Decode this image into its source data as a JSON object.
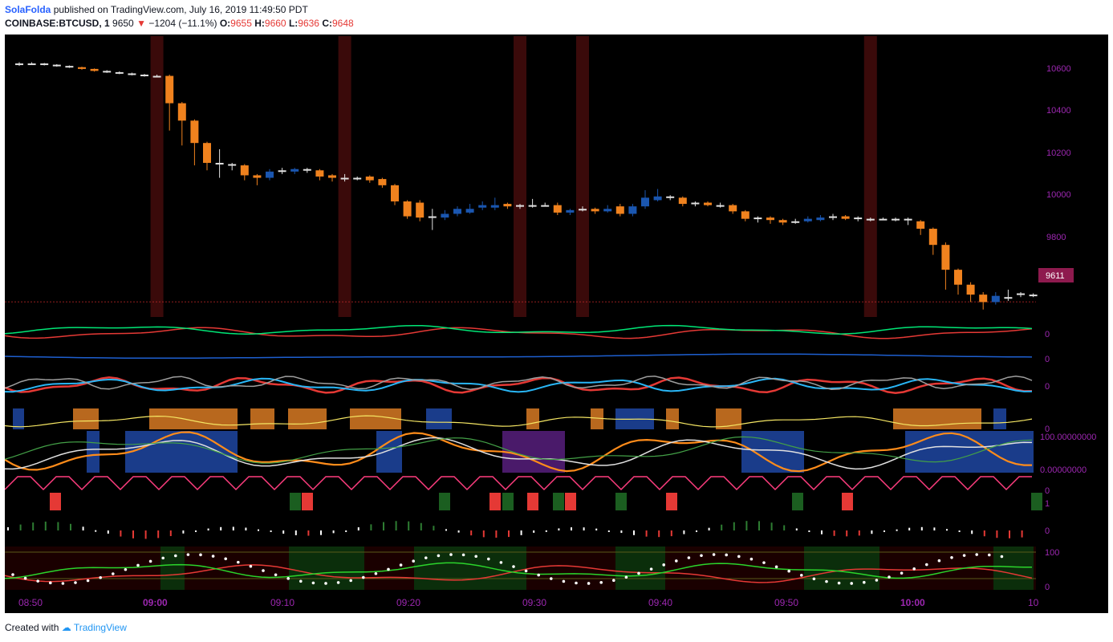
{
  "header": {
    "author": "SolaFolda",
    "published_text": "published on TradingView.com, July 16, 2019 11:49:50 PDT",
    "symbol": "COINBASE:BTCUSD, 1",
    "last": "9650",
    "change": "−1204 (−11.1%)",
    "o_label": "O:",
    "o": "9655",
    "h_label": "H:",
    "h": "9660",
    "l_label": "L:",
    "l": "9636",
    "c_label": "C:",
    "c": "9648"
  },
  "price_axis": {
    "ticks": [
      "10600",
      "10400",
      "10200",
      "10000",
      "9800"
    ],
    "current_price": "9611"
  },
  "indicator_axis": {
    "zero_1": "0",
    "zero_2": "0",
    "zero_3": "0",
    "zero_4": "0",
    "stoch_top": "100.00000000",
    "stoch_bottom": "0.00000000",
    "zero_5": "0",
    "one": "1",
    "zero_6": "0",
    "rsi_top": "100",
    "rsi_bottom": "0"
  },
  "time_axis": [
    "08:50",
    "09:00",
    "09:10",
    "09:20",
    "09:30",
    "09:40",
    "09:50",
    "10:00",
    "10"
  ],
  "footer": {
    "created_with": "Created with",
    "brand": "TradingView"
  },
  "colors": {
    "bull": "#1a56b0",
    "bear": "#f0821e",
    "doji": "#e0e0e0",
    "highlight": "#3a0a0a",
    "price_label_bg": "#8e1a4e",
    "axis_text": "#9c27b0"
  },
  "chart_data": {
    "type": "candlestick",
    "title": "",
    "x": [
      "08:49",
      "08:50",
      "08:51",
      "08:52",
      "08:53",
      "08:54",
      "08:55",
      "08:56",
      "08:57",
      "08:58",
      "08:59",
      "09:00",
      "09:01",
      "09:02",
      "09:03",
      "09:04",
      "09:05",
      "09:06",
      "09:07",
      "09:08",
      "09:09",
      "09:10",
      "09:11",
      "09:12",
      "09:13",
      "09:14",
      "09:15",
      "09:16",
      "09:17",
      "09:18",
      "09:19",
      "09:20",
      "09:21",
      "09:22",
      "09:23",
      "09:24",
      "09:25",
      "09:26",
      "09:27",
      "09:28",
      "09:29",
      "09:30",
      "09:31",
      "09:32",
      "09:33",
      "09:34",
      "09:35",
      "09:36",
      "09:37",
      "09:38",
      "09:39",
      "09:40",
      "09:41",
      "09:42",
      "09:43",
      "09:44",
      "09:45",
      "09:46",
      "09:47",
      "09:48",
      "09:49",
      "09:50",
      "09:51",
      "09:52",
      "09:53",
      "09:54",
      "09:55",
      "09:56",
      "09:57",
      "09:58",
      "09:59",
      "10:00",
      "10:01",
      "10:02",
      "10:03",
      "10:04",
      "10:05",
      "10:06",
      "10:07",
      "10:08",
      "10:09",
      "10:10"
    ],
    "open": [
      10565,
      10570,
      10570,
      10565,
      10560,
      10555,
      10548,
      10540,
      10535,
      10530,
      10525,
      10520,
      10520,
      10410,
      10340,
      10250,
      10170,
      10165,
      10160,
      10120,
      10110,
      10135,
      10135,
      10145,
      10140,
      10120,
      10110,
      10110,
      10115,
      10105,
      10080,
      10015,
      10010,
      9955,
      9950,
      9965,
      9970,
      9990,
      9990,
      10005,
      9995,
      10000,
      10000,
      10000,
      9970,
      9980,
      9985,
      9975,
      9995,
      9965,
      9995,
      10020,
      10035,
      10030,
      10005,
      10010,
      10000,
      10000,
      9975,
      9945,
      9950,
      9940,
      9935,
      9935,
      9940,
      9950,
      9955,
      9950,
      9945,
      9945,
      9945,
      9940,
      9935,
      9905,
      9840,
      9740,
      9680,
      9640,
      9610,
      9625,
      9645,
      9640
    ],
    "close": [
      10570,
      10570,
      10565,
      10560,
      10555,
      10548,
      10540,
      10535,
      10530,
      10525,
      10520,
      10520,
      10410,
      10340,
      10250,
      10170,
      10165,
      10160,
      10120,
      10110,
      10135,
      10140,
      10145,
      10140,
      10115,
      10110,
      10110,
      10110,
      10100,
      10080,
      10015,
      9955,
      9950,
      9955,
      9965,
      9985,
      9985,
      10000,
      10000,
      9995,
      10000,
      10000,
      10000,
      9970,
      9980,
      9985,
      9975,
      9985,
      9965,
      9995,
      10030,
      10035,
      10030,
      10005,
      10010,
      10000,
      10000,
      9975,
      9945,
      9950,
      9940,
      9930,
      9935,
      9945,
      9950,
      9955,
      9945,
      9945,
      9945,
      9945,
      9945,
      9945,
      9905,
      9840,
      9740,
      9680,
      9640,
      9610,
      9635,
      9630,
      9640,
      9640
    ],
    "high": [
      10575,
      10575,
      10572,
      10567,
      10562,
      10557,
      10550,
      10543,
      10538,
      10533,
      10528,
      10525,
      10525,
      10415,
      10345,
      10255,
      10225,
      10170,
      10165,
      10125,
      10145,
      10150,
      10150,
      10150,
      10145,
      10125,
      10125,
      10115,
      10120,
      10110,
      10085,
      10020,
      10020,
      9985,
      9980,
      9995,
      10005,
      10015,
      10030,
      10010,
      10005,
      10025,
      10010,
      10010,
      9985,
      9995,
      9990,
      10000,
      10005,
      10005,
      10060,
      10065,
      10040,
      10035,
      10015,
      10015,
      10010,
      10005,
      9980,
      9955,
      9955,
      9945,
      9945,
      9955,
      9960,
      9965,
      9960,
      9955,
      9950,
      9950,
      9950,
      9950,
      9940,
      9910,
      9850,
      9745,
      9690,
      9650,
      9650,
      9660,
      9650,
      9645
    ],
    "low": [
      10560,
      10565,
      10562,
      10557,
      10552,
      10545,
      10537,
      10532,
      10527,
      10522,
      10517,
      10515,
      10300,
      10240,
      10160,
      10140,
      10110,
      10140,
      10100,
      10080,
      10100,
      10125,
      10125,
      10130,
      10100,
      10095,
      10095,
      10100,
      10090,
      10070,
      10000,
      9945,
      9935,
      9900,
      9940,
      9955,
      9965,
      9980,
      9980,
      9985,
      9985,
      9990,
      9995,
      9960,
      9960,
      9975,
      9965,
      9970,
      9955,
      9955,
      9985,
      10015,
      10020,
      9995,
      9995,
      9995,
      9990,
      9965,
      9935,
      9930,
      9925,
      9920,
      9925,
      9930,
      9935,
      9940,
      9940,
      9935,
      9935,
      9940,
      9935,
      9920,
      9880,
      9800,
      9660,
      9640,
      9610,
      9580,
      9600,
      9615,
      9630,
      9630
    ],
    "ylim": [
      9550,
      10680
    ],
    "y_ticks": [
      9800,
      10000,
      10200,
      10400,
      10600
    ],
    "last_price": 9611,
    "highlighted_bars": [
      "09:00",
      "09:15",
      "09:29",
      "09:34",
      "09:57"
    ],
    "indicators": {
      "line1_zero": 0,
      "line2_zero": 0,
      "stoch_range": [
        0,
        100
      ],
      "rsi_range": [
        0,
        100
      ]
    }
  }
}
